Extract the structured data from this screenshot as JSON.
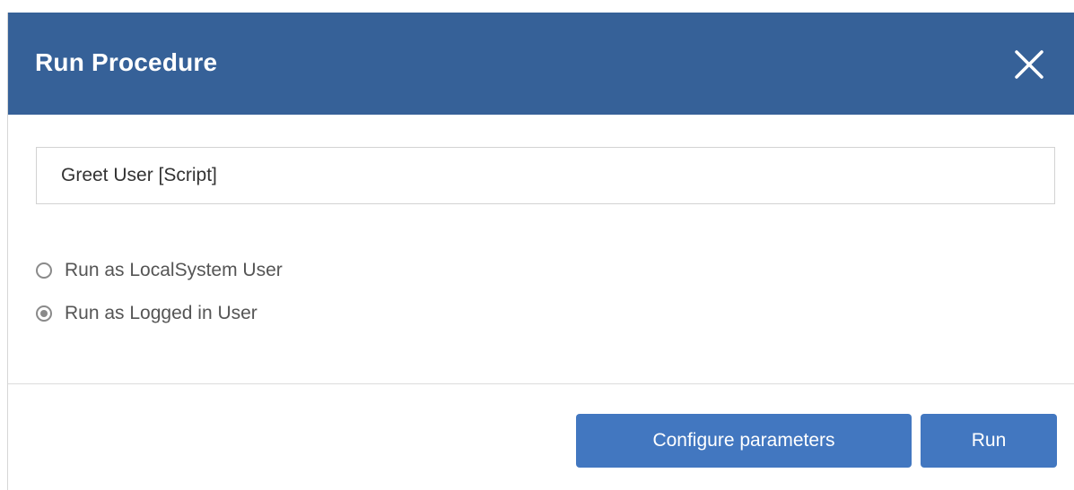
{
  "dialog": {
    "title": "Run Procedure",
    "close_icon": "close-icon"
  },
  "procedure": {
    "selected_value": "Greet User [Script]"
  },
  "run_as": {
    "options": [
      {
        "label": "Run as LocalSystem User",
        "checked": false
      },
      {
        "label": "Run as Logged in User",
        "checked": true
      }
    ]
  },
  "footer": {
    "configure_label": "Configure parameters",
    "run_label": "Run"
  },
  "colors": {
    "header_bg": "#366198",
    "button_bg": "#4277c0"
  }
}
